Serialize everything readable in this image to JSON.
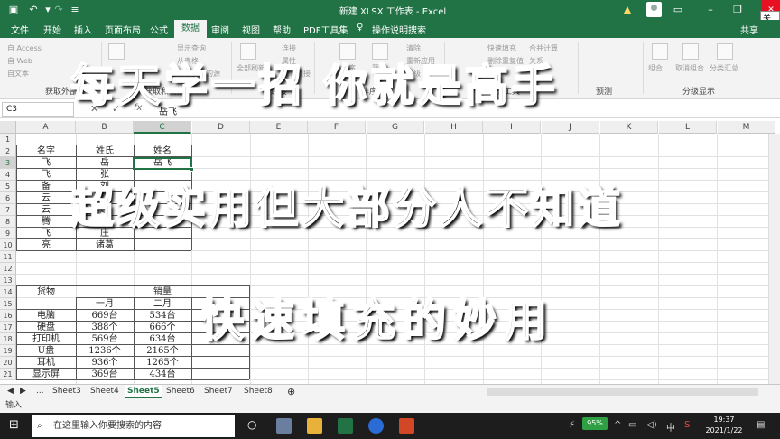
{
  "titlebar": {
    "title": "新建 XLSX 工作表 - Excel",
    "warning_icon": "warning-icon",
    "close_tooltip": "关闭"
  },
  "menu": {
    "items": [
      "文件",
      "开始",
      "插入",
      "页面布局",
      "公式",
      "数据",
      "审阅",
      "视图",
      "帮助",
      "PDF工具集",
      "操作说明搜索"
    ],
    "active": "数据",
    "share": "共享"
  },
  "ribbon": {
    "get_external": [
      "自 Access",
      "自 Web",
      "自文本"
    ],
    "groups": [
      "获取外部",
      "获取和转换",
      "连接",
      "排序和筛选",
      "数据工具",
      "预测",
      "分级显示"
    ],
    "labels": [
      "显示查询",
      "从表格",
      "最近使用的源",
      "全部刷新",
      "连接",
      "属性",
      "编辑链接",
      "排序",
      "筛选",
      "清除",
      "重新应用",
      "高级",
      "快速填充",
      "合并计算",
      "删除重复值",
      "关系",
      "组合",
      "取消组合",
      "分类汇总"
    ]
  },
  "formula_bar": {
    "name_box": "C3",
    "cancel": "✕",
    "enter": "✓",
    "fx": "fx",
    "value": "岳飞"
  },
  "columns": [
    "A",
    "B",
    "C",
    "D",
    "E",
    "F",
    "G",
    "H",
    "I",
    "J",
    "K",
    "L",
    "M"
  ],
  "rows": [
    "1",
    "2",
    "3",
    "4",
    "5",
    "6",
    "7",
    "8",
    "9",
    "10",
    "11",
    "12",
    "13",
    "14",
    "15",
    "16",
    "17",
    "18",
    "19",
    "20",
    "21"
  ],
  "table1": {
    "headers": [
      "名字",
      "姓氏",
      "姓名"
    ],
    "rows": [
      [
        "飞",
        "岳",
        "岳飞"
      ],
      [
        "飞",
        "张",
        ""
      ],
      [
        "备",
        "刘",
        ""
      ],
      [
        "云",
        "赵",
        ""
      ],
      [
        "云",
        "赵",
        ""
      ],
      [
        "腾",
        "马",
        ""
      ],
      [
        "飞",
        "庄",
        ""
      ],
      [
        "亮",
        "诸葛",
        ""
      ]
    ]
  },
  "table2": {
    "header_goods": "货物",
    "header_sales": "销量",
    "months": [
      "一月",
      "二月"
    ],
    "rows": [
      [
        "电脑",
        "669台",
        "534台"
      ],
      [
        "硬盘",
        "388个",
        "666个"
      ],
      [
        "打印机",
        "569台",
        "634台"
      ],
      [
        "U盘",
        "1236个",
        "2165个"
      ],
      [
        "耳机",
        "936个",
        "1265个"
      ],
      [
        "显示屏",
        "369台",
        "434台"
      ]
    ]
  },
  "overlay": {
    "line1": "每天学一招 你就是高手",
    "line2": "超级实用但大部分人不知道",
    "line3": "快速填充的妙用"
  },
  "sheets": {
    "ellipsis": "...",
    "tabs": [
      "Sheet3",
      "Sheet4",
      "Sheet5",
      "Sheet6",
      "Sheet7",
      "Sheet8"
    ],
    "active": "Sheet5",
    "add": "⊕"
  },
  "status": {
    "mode": "输入"
  },
  "taskbar": {
    "search_placeholder": "在这里输入你要搜索的内容",
    "battery": "95%",
    "ime": "中",
    "time": "19:37",
    "date": "2021/1/22"
  },
  "colors": {
    "excel_green": "#217346",
    "close_red": "#e81123"
  }
}
